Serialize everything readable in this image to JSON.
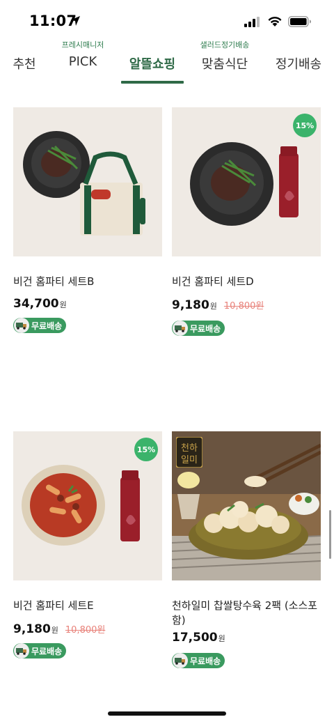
{
  "status": {
    "time": "11:07"
  },
  "tabs": [
    {
      "label": "추천",
      "sub": ""
    },
    {
      "label": "PICK",
      "sub": "프레시매니저"
    },
    {
      "label": "알뜰쇼핑",
      "sub": "",
      "active": true
    },
    {
      "label": "맞춤식단",
      "sub": "샐러드정기배송"
    },
    {
      "label": "정기배송",
      "sub": ""
    }
  ],
  "products": [
    {
      "name": "비건 홈파티 세트B",
      "price": "34,700",
      "won": "원",
      "original_price": "",
      "discount": "",
      "shipping": "무료배송"
    },
    {
      "name": "비건 홈파티 세트D",
      "price": "9,180",
      "won": "원",
      "original_price": "10,800원",
      "discount": "15%",
      "shipping": "무료배송"
    },
    {
      "name": "비건 홈파티 세트E",
      "price": "9,180",
      "won": "원",
      "original_price": "10,800원",
      "discount": "15%",
      "shipping": "무료배송"
    },
    {
      "name": "천하일미 찹쌀탕수육 2팩 (소스포함)",
      "price": "17,500",
      "won": "원",
      "original_price": "",
      "discount": "",
      "shipping": "무료배송",
      "brand_logo": "천하일미"
    }
  ],
  "icons": {
    "location": "location-arrow-icon",
    "signal": "cellular-signal-icon",
    "wifi": "wifi-icon",
    "battery": "battery-icon",
    "shipping": "delivery-truck-icon"
  },
  "colors": {
    "accent": "#2f6a47",
    "badge": "#3bb36b",
    "shipping_badge": "#3a9a5f",
    "strike_price": "#e8827a"
  }
}
